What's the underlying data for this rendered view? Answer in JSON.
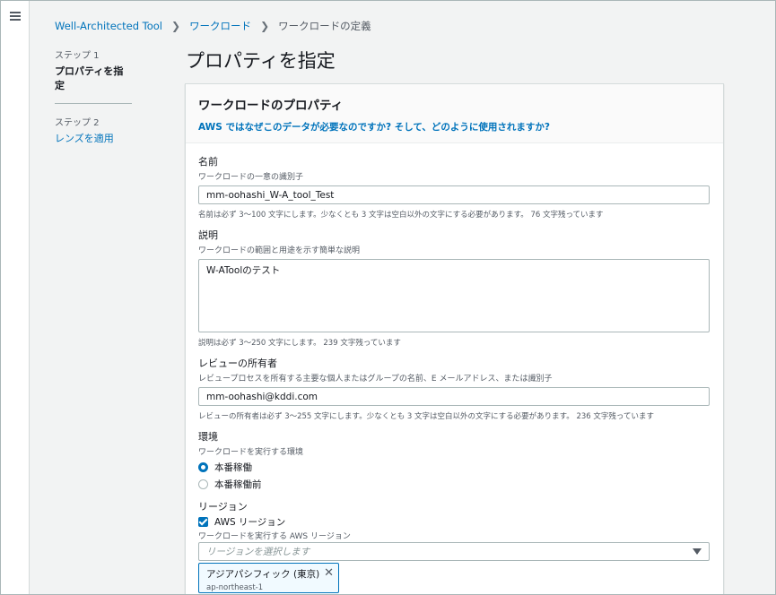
{
  "breadcrumb": {
    "root": "Well-Architected Tool",
    "section": "ワークロード",
    "current": "ワークロードの定義"
  },
  "steps": {
    "step1_num": "ステップ 1",
    "step1_title": "プロパティを指定",
    "step2_num": "ステップ 2",
    "step2_title": "レンズを適用"
  },
  "page_title": "プロパティを指定",
  "panel": {
    "title": "ワークロードのプロパティ",
    "info_link": "AWS ではなぜこのデータが必要なのですか? そして、どのように使用されますか?"
  },
  "name_field": {
    "label": "名前",
    "description": "ワークロードの一意の識別子",
    "value": "mm-oohashi_W-A_tool_Test",
    "constraint": "名前は必ず 3～100 文字にします。少なくとも 3 文字は空白以外の文字にする必要があります。 76 文字残っています"
  },
  "description_field": {
    "label": "説明",
    "description": "ワークロードの範囲と用途を示す簡単な説明",
    "value": "W-AToolのテスト",
    "constraint": "説明は必ず 3～250 文字にします。 239 文字残っています"
  },
  "owner_field": {
    "label": "レビューの所有者",
    "description": "レビュープロセスを所有する主要な個人またはグループの名前、E メールアドレス、または識別子",
    "value": "mm-oohashi@kddi.com",
    "constraint": "レビューの所有者は必ず 3～255 文字にします。少なくとも 3 文字は空白以外の文字にする必要があります。 236 文字残っています"
  },
  "environment_field": {
    "label": "環境",
    "description": "ワークロードを実行する環境",
    "options": [
      "本番稼働",
      "本番稼働前"
    ],
    "selected": "本番稼働"
  },
  "region_field": {
    "label": "リージョン",
    "checkbox_label": "AWS リージョン",
    "description": "ワークロードを実行する AWS リージョン",
    "placeholder": "リージョンを選択します",
    "token_title": "アジアパシフィック (東京)",
    "token_sub": "ap-northeast-1"
  },
  "colors": {
    "link": "#0073bb",
    "text": "#16191f",
    "muted": "#545b64",
    "border": "#aab7b8",
    "background": "#f2f3f3"
  },
  "icons": [
    "hamburger-menu-icon",
    "chevron-right-icon",
    "chevron-right-icon",
    "caret-down-icon",
    "close-icon",
    "check-icon"
  ]
}
